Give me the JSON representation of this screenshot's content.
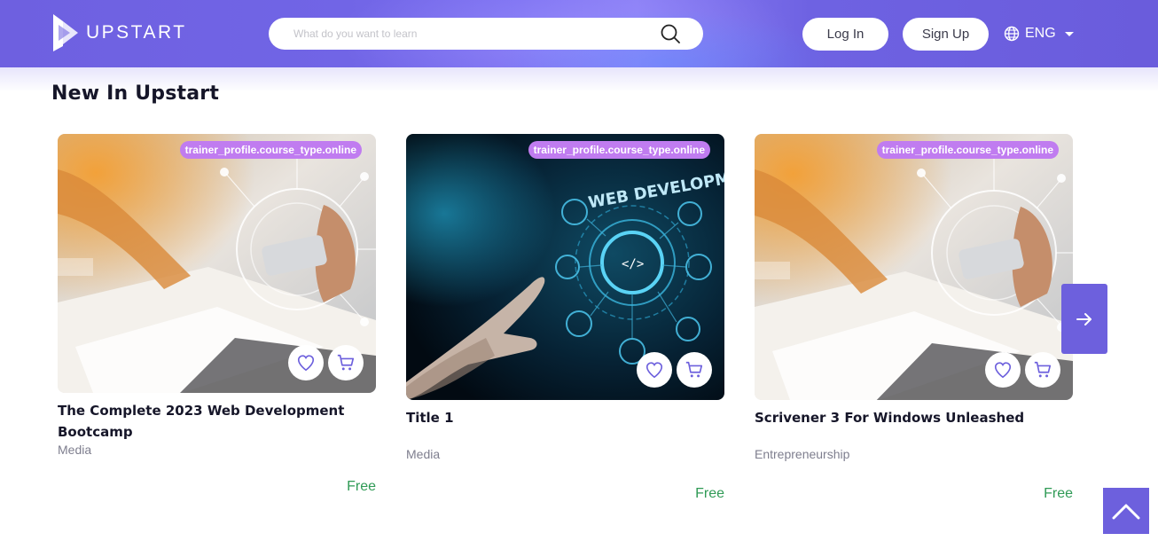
{
  "header": {
    "brand": "UPSTART",
    "search_placeholder": "What do you want to learn",
    "login_label": "Log In",
    "signup_label": "Sign Up",
    "language_label": "ENG"
  },
  "section": {
    "title": "New In Upstart"
  },
  "cards": [
    {
      "badge": "trainer_profile.course_type.online",
      "title": "The Complete 2023 Web Development Bootcamp",
      "category": "Media",
      "price": "Free",
      "image": "notebook-tablet-photo"
    },
    {
      "badge": "trainer_profile.course_type.online",
      "title": "Title 1",
      "category": "Media",
      "price": "Free",
      "image": "web-development-photo",
      "image_text": "WEB DEVELOPMENT"
    },
    {
      "badge": "trainer_profile.course_type.online",
      "title": "Scrivener 3 For Windows Unleashed",
      "category": "Entrepreneurship",
      "price": "Free",
      "image": "notebook-tablet-photo"
    }
  ],
  "colors": {
    "brand": "#6d60dd",
    "badge": "#c07cf0",
    "price": "#2f9a55",
    "title": "#161629"
  },
  "icons": {
    "search": "search-icon",
    "globe": "globe-icon",
    "favorite": "heart-icon",
    "cart": "cart-icon",
    "next": "arrow-right-icon",
    "top": "chevron-up-icon"
  }
}
